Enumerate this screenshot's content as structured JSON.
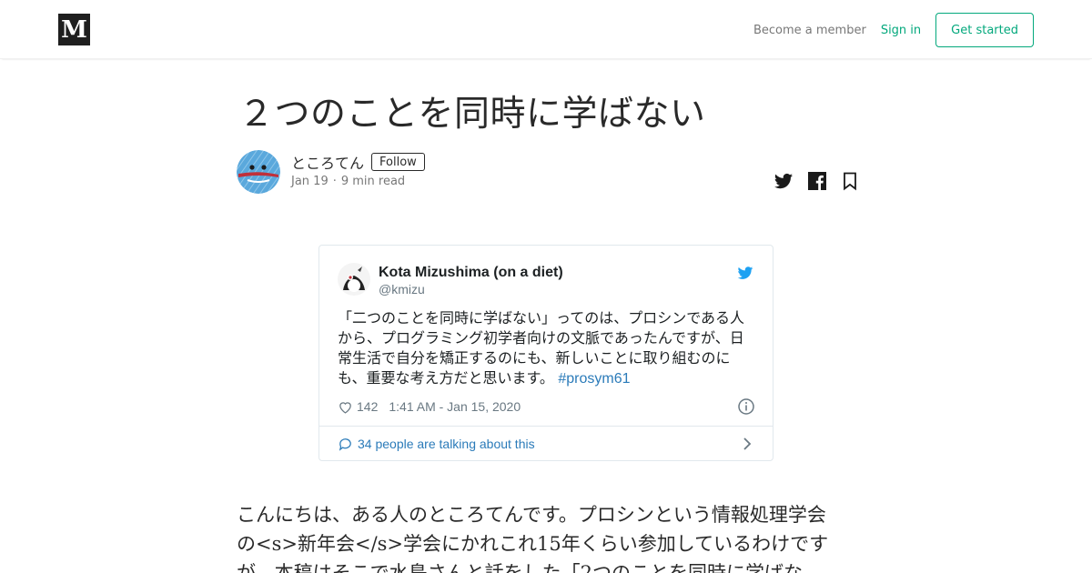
{
  "header": {
    "logo_text": "M",
    "become_member": "Become a member",
    "sign_in": "Sign in",
    "get_started": "Get started"
  },
  "article": {
    "title": "２つのことを同時に学ばない",
    "author": "ところてん",
    "follow_label": "Follow",
    "date": "Jan 19",
    "read_time": "9 min read",
    "body_lines": [
      "こんにちは、ある人のところてんです。プロシンという情報処理学会",
      "の<s>新年会</s>学会にかれこれ15年くらい参加しているわけです",
      "が、本稿はそこで水島さんと話をした「2つのことを同時に学ばな"
    ]
  },
  "share_icons": [
    "twitter-icon",
    "facebook-icon",
    "bookmark-icon"
  ],
  "tweet": {
    "name": "Kota Mizushima (on a diet)",
    "handle": "@kmizu",
    "text": "「二つのことを同時に学ばない」ってのは、プロシンである人から、プログラミング初学者向けの文脈であったんですが、日常生活で自分を矯正するのにも、新しいことに取り組むのにも、重要な考え方だと思います。",
    "hashtag": "#prosym61",
    "likes": "142",
    "timestamp": "1:41 AM - Jan 15, 2020",
    "talking": "34 people are talking about this"
  },
  "colors": {
    "accent_green": "#03a87c",
    "twitter_blue": "#1da1f2",
    "link_blue": "#2b7bb9",
    "text_dark": "#1c2022",
    "text_muted": "#697882"
  }
}
